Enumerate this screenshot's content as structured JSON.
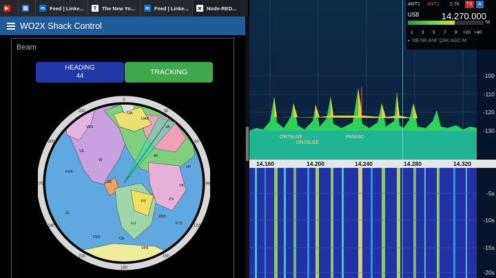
{
  "browser": {
    "tabs": [
      {
        "label": "",
        "icon": "youtube-icon"
      },
      {
        "label": "",
        "icon": "newsletter-icon"
      },
      {
        "label": "Feed | Linke...",
        "icon": "linkedin-icon"
      },
      {
        "label": "The New Yo...",
        "icon": "nytimes-icon"
      },
      {
        "label": "Feed | Linke...",
        "icon": "linkedin-icon"
      },
      {
        "label": "Node-RED...",
        "icon": "node-red-icon"
      }
    ]
  },
  "app": {
    "title": "WO2X Shack Control",
    "section": "Beam",
    "heading_label": "HEADING",
    "heading_value": "44",
    "tracking_label": "TRACKING"
  },
  "map": {
    "compass": [
      "0",
      "30",
      "60",
      "90",
      "120",
      "150",
      "180",
      "210",
      "240",
      "270",
      "300",
      "330"
    ],
    "regions": [
      {
        "t": "VE8"
      },
      {
        "t": "VE"
      },
      {
        "t": "W"
      },
      {
        "t": "XE"
      },
      {
        "t": "PY"
      },
      {
        "t": "LU"
      },
      {
        "t": "CE"
      },
      {
        "t": "ZL"
      },
      {
        "t": "VK"
      },
      {
        "t": "JA"
      },
      {
        "t": "UA9"
      },
      {
        "t": "UA"
      },
      {
        "t": "ZS"
      },
      {
        "t": "CE0"
      },
      {
        "t": "KH6"
      },
      {
        "t": "VP8"
      },
      {
        "t": "5R"
      },
      {
        "t": "FT5"
      },
      {
        "t": "4X"
      },
      {
        "t": "ZD8"
      }
    ]
  },
  "sdr": {
    "antenna1": "ANT1",
    "antenna2": "ANT1",
    "bandwidth": "2.7K",
    "tx": "TX",
    "a": "A",
    "mode": "USB",
    "frequency": "14.270.000",
    "smeter_level": 0.62,
    "s_scale": [
      "1",
      "3",
      "5",
      "7",
      "9",
      "+20",
      "+40"
    ],
    "s_unit": "S8",
    "rx_controls": "NB NR ANF QSK AGC-M",
    "db_labels": [
      "-100",
      "-110",
      "-120",
      "-130"
    ],
    "freq_labels": [
      "14.160",
      "14.200",
      "14.240",
      "14.280",
      "14.320"
    ],
    "time_labels": [
      "-5s",
      "-10s",
      "-15s",
      "-20s"
    ],
    "spots": [
      "ON7SLGE",
      "ON7SLGE",
      "PA5A3C"
    ],
    "colors": {
      "header": "#1f5c99",
      "heading_btn": "#1f39a8",
      "tracking_btn": "#3fa84a",
      "waterfall": "#2232a6"
    }
  }
}
